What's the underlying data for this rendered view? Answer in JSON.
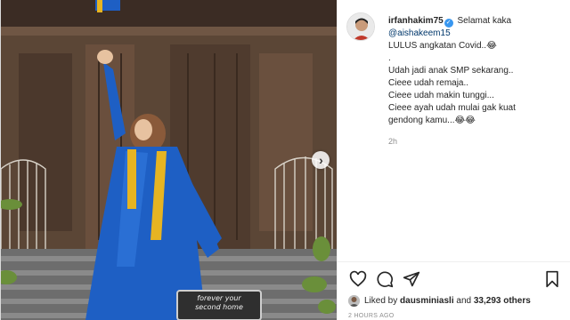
{
  "post": {
    "username": "irfanhakim75",
    "verified": true,
    "caption": {
      "lead": "Selamat kaka",
      "mention": "@aishakeem15",
      "line2": "LULUS angkatan Covid..😂",
      "dot": ".",
      "lines": [
        "Udah jadi anak SMP sekarang..",
        "Cieee udah remaja..",
        "Cieee udah makin tunggi...",
        "Cieee ayah udah mulai gak kuat",
        "gendong kamu...😂😂"
      ]
    },
    "time": "2h",
    "likes": {
      "prefix": "Liked by",
      "user": "dausminiasli",
      "and": "and",
      "count": "33,293 others"
    },
    "ago": "2 HOURS AGO"
  },
  "media": {
    "sign_line1": "forever your",
    "sign_line2": "second home"
  },
  "icons": {
    "like": "heart-icon",
    "comment": "comment-icon",
    "share": "share-icon",
    "save": "bookmark-icon",
    "next": "chevron-right-icon"
  },
  "colors": {
    "gown": "#1e5fc4",
    "hijab": "#8a5a3a",
    "sash": "#e6b422",
    "link": "#00376b",
    "verified": "#3897f0"
  }
}
